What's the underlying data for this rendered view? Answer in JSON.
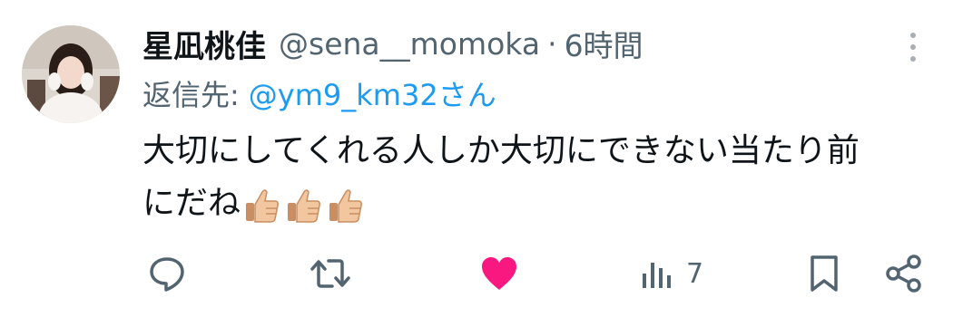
{
  "tweet": {
    "display_name": "星凪桃佳",
    "handle": "@sena__momoka",
    "separator": "·",
    "time": "6時間",
    "reply_label": "返信先:",
    "reply_target": "@ym9_km32さん",
    "text_line_1": "大切にしてくれる人しか大切にできない当たり前",
    "text_line_2": "にだね",
    "emoji": [
      "thumbs-up",
      "thumbs-up",
      "thumbs-up"
    ]
  },
  "actions": {
    "views_count": "7",
    "liked": true
  },
  "colors": {
    "text": "#0f1419",
    "secondary": "#536471",
    "link": "#1d9bf0",
    "like": "#f91880"
  }
}
